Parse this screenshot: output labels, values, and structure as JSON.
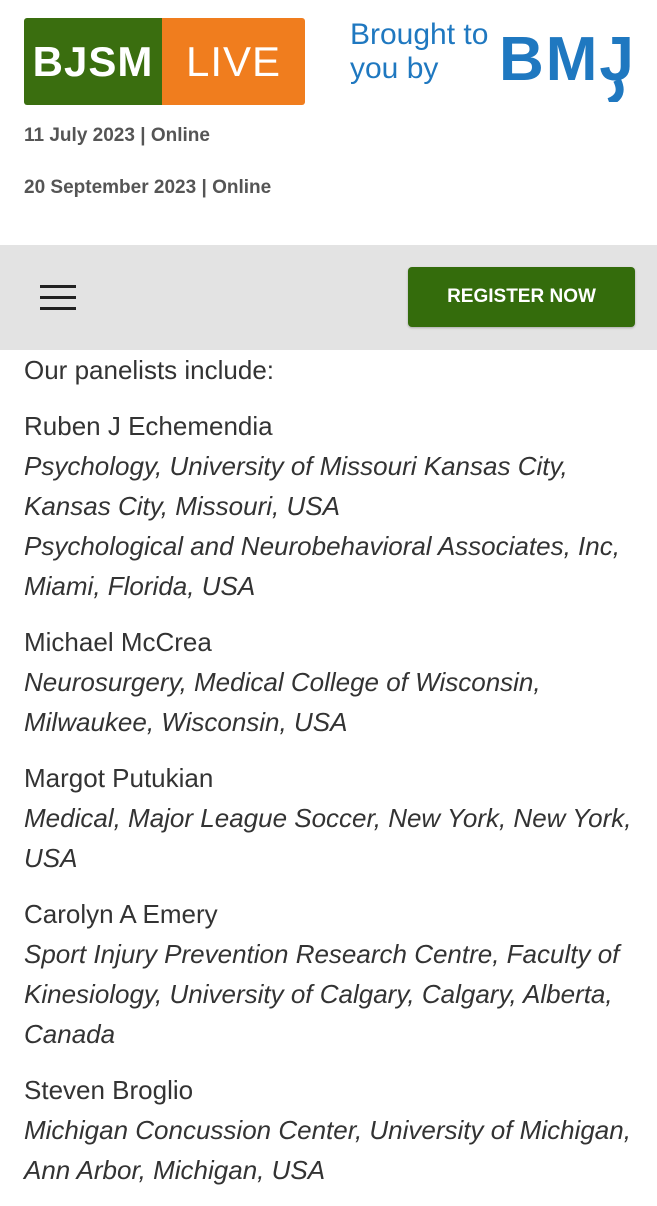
{
  "header": {
    "logo_left": "BJSM",
    "logo_right": "LIVE",
    "brought_by": "Brought to you by",
    "publisher_logo": "BMJ",
    "dates": [
      {
        "date": "11 July 2023",
        "separator": "|",
        "mode": "Online"
      },
      {
        "date": "20 September 2023",
        "separator": "|",
        "mode": "Online"
      }
    ],
    "colors": {
      "logo_green": "#3a6e0f",
      "logo_orange": "#f07d1e",
      "bmj_blue": "#1f78c0"
    }
  },
  "nav": {
    "menu_icon": "hamburger-menu-icon",
    "register_label": "REGISTER NOW",
    "register_color": "#346c0c",
    "background": "#e3e3e3"
  },
  "content": {
    "intro": "Our panelists include:",
    "panelists": [
      {
        "name": "Ruben J Echemendia",
        "affiliations": [
          "Psychology, University of Missouri Kansas City, Kansas City, Missouri, USA",
          "Psychological and Neurobehavioral Associates, Inc, Miami, Florida, USA"
        ]
      },
      {
        "name": "Michael McCrea",
        "affiliations": [
          "Neurosurgery, Medical College of Wisconsin, Milwaukee, Wisconsin, USA"
        ]
      },
      {
        "name": "Margot Putukian",
        "affiliations": [
          "Medical, Major League Soccer, New York, New York, USA"
        ]
      },
      {
        "name": "Carolyn A Emery",
        "affiliations": [
          "Sport Injury Prevention Research Centre, Faculty of Kinesiology, University of Calgary, Calgary, Alberta, Canada"
        ]
      },
      {
        "name": "Steven Broglio",
        "affiliations": [
          "Michigan Concussion Center, University of Michigan, Ann Arbor, Michigan, USA"
        ]
      }
    ]
  }
}
